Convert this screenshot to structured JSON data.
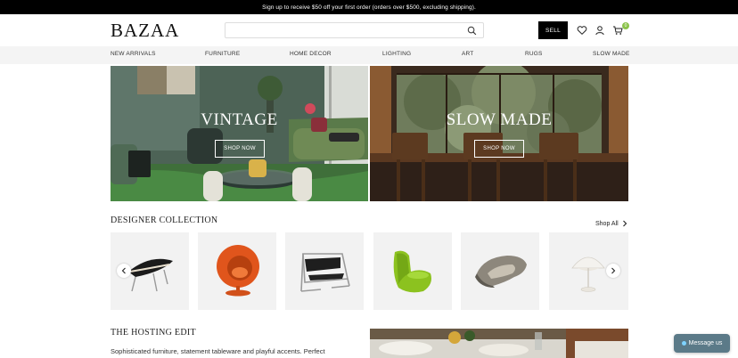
{
  "announcement": "Sign up to receive $50 off your first order (orders over $500, excluding shipping).",
  "header": {
    "logo": "BAZAA",
    "search_placeholder": "",
    "sell_label": "SELL",
    "cart_count": "0",
    "icons": [
      "search-icon",
      "heart-icon",
      "user-icon",
      "cart-icon"
    ]
  },
  "nav": [
    "NEW ARRIVALS",
    "FURNITURE",
    "HOME DECOR",
    "LIGHTING",
    "ART",
    "RUGS",
    "SLOW MADE"
  ],
  "hero": [
    {
      "title": "VINTAGE",
      "button": "SHOP NOW"
    },
    {
      "title": "SLOW MADE",
      "button": "SHOP NOW"
    }
  ],
  "designer": {
    "title": "DESIGNER COLLECTION",
    "shop_all": "Shop All",
    "products": [
      "black-shell-chair",
      "orange-ball-chair",
      "wassily-chair",
      "green-lounge-chair",
      "sculptural-armchair",
      "white-table-lamp"
    ]
  },
  "hosting": {
    "title": "THE HOSTING EDIT",
    "text": "Sophisticated furniture, statement tableware and playful accents. Perfect"
  },
  "chat": {
    "label": "Message us"
  },
  "colors": {
    "accent_badge": "#8bc34a",
    "chat_bg": "#5b7a88"
  }
}
